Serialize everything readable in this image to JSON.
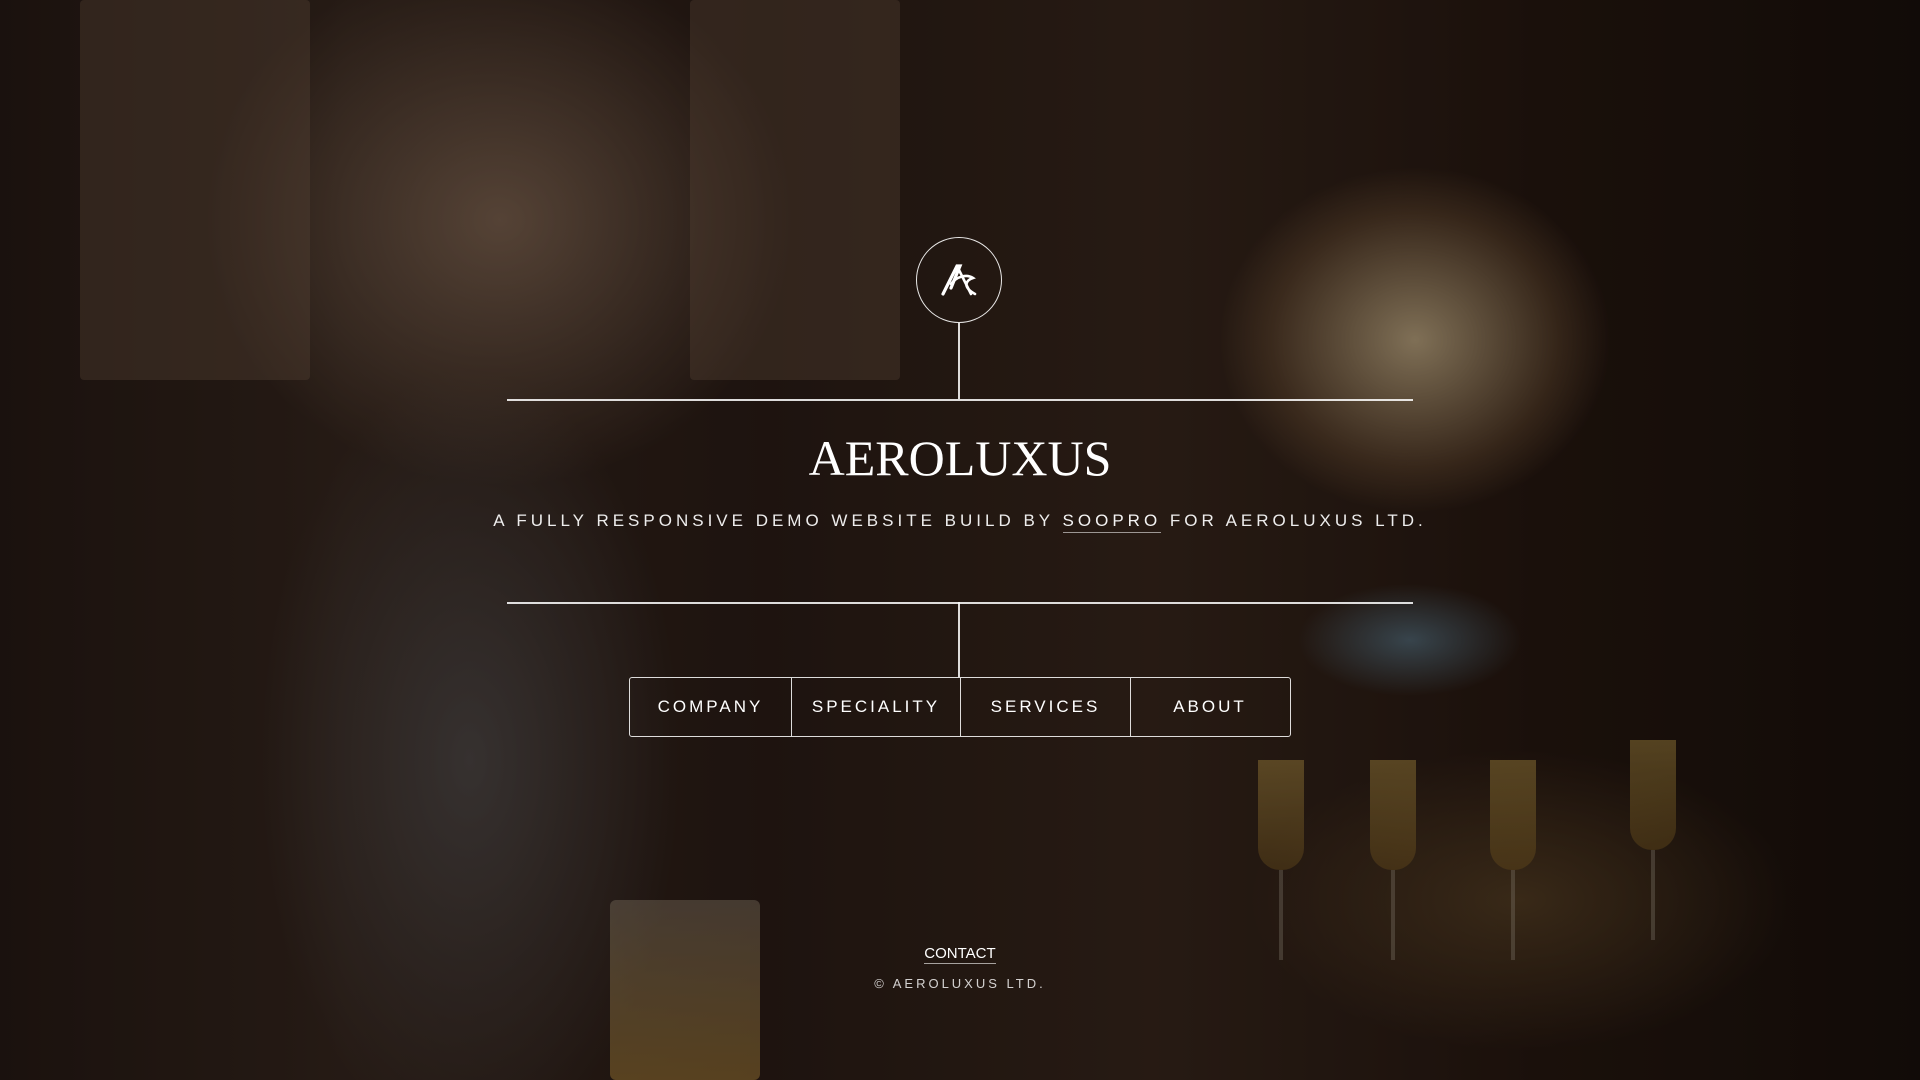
{
  "brand": {
    "name": "AEROLUXUS",
    "logo_icon": "aeroluxus-monogram-icon"
  },
  "tagline": {
    "before": "A FULLY RESPONSIVE DEMO WEBSITE BUILD BY ",
    "link": "SOOPRO",
    "after": " FOR AEROLUXUS LTD."
  },
  "nav": {
    "items": [
      {
        "label": "COMPANY"
      },
      {
        "label": "SPECIALITY"
      },
      {
        "label": "SERVICES"
      },
      {
        "label": "ABOUT"
      }
    ]
  },
  "footer": {
    "contact": "CONTACT",
    "copyright": "© AEROLUXUS LTD."
  }
}
